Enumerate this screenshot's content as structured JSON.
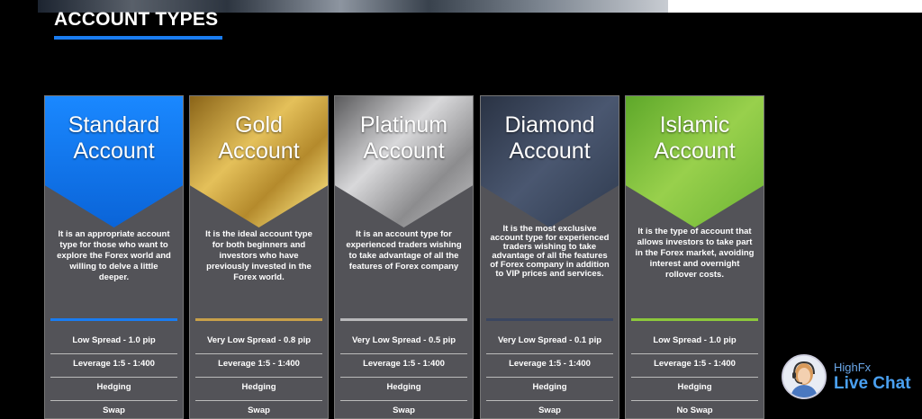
{
  "section": {
    "title": "ACCOUNT TYPES"
  },
  "accounts": [
    {
      "title_line1": "Standard",
      "title_line2": "Account",
      "description": "It is an appropriate account type for those who want to explore the Forex world and willing to delve a little deeper.",
      "spread": "Low Spread - 1.0 pip",
      "leverage": "Leverage 1:5 - 1:400",
      "hedging": "Hedging",
      "swap": "Swap",
      "header_gradient": "linear-gradient(180deg,#1a88ff,#0a64d8)",
      "bar_color": "#1a7cf0"
    },
    {
      "title_line1": "Gold",
      "title_line2": "Account",
      "description": "It is the ideal account type for both beginners and investors who have previously invested in the Forex world.",
      "spread": "Very Low Spread - 0.8 pip",
      "leverage": "Leverage 1:5 - 1:400",
      "hedging": "Hedging",
      "swap": "Swap",
      "header_gradient": "linear-gradient(135deg,#8a6418 0%,#e4c05a 40%,#b48a2c 65%,#e8cc6a 85%,#8a6418 100%)",
      "bar_color": "#c8a04a"
    },
    {
      "title_line1": "Platinum",
      "title_line2": "Account",
      "description": "It is an account type for experienced traders wishing to take advantage of all the features of Forex company",
      "spread": "Very Low Spread - 0.5 pip",
      "leverage": "Leverage 1:5 - 1:400",
      "hedging": "Hedging",
      "swap": "Swap",
      "header_gradient": "linear-gradient(135deg,#5a5a5c 0%,#d8d8da 40%,#8c8c8e 70%,#c4c4c6 100%)",
      "bar_color": "#b8b8ba"
    },
    {
      "title_line1": "Diamond",
      "title_line2": "Account",
      "description": "It is the most exclusive account type for experienced traders wishing to take advantage of all the features of Forex company in addition to VIP prices and services.",
      "spread": "Very Low Spread - 0.1 pip",
      "leverage": "Leverage 1:5 - 1:400",
      "hedging": "Hedging",
      "swap": "Swap",
      "header_gradient": "linear-gradient(135deg,#2a3344 0%,#4a5770 50%,#2e3a4e 100%)",
      "bar_color": "#3a4660"
    },
    {
      "title_line1": "Islamic",
      "title_line2": "Account",
      "description": "It is the type of account that allows investors to take part in the Forex market, avoiding interest and overnight rollover costs.",
      "spread": "Low Spread - 1.0 pip",
      "leverage": "Leverage 1:5 - 1:400",
      "hedging": "Hedging",
      "swap": "No Swap",
      "header_gradient": "linear-gradient(135deg,#5ea82a 0%,#98d04c 50%,#6cb434 100%)",
      "bar_color": "#8cc83c"
    }
  ],
  "chat": {
    "title": "HighFx",
    "label": "Live Chat"
  }
}
